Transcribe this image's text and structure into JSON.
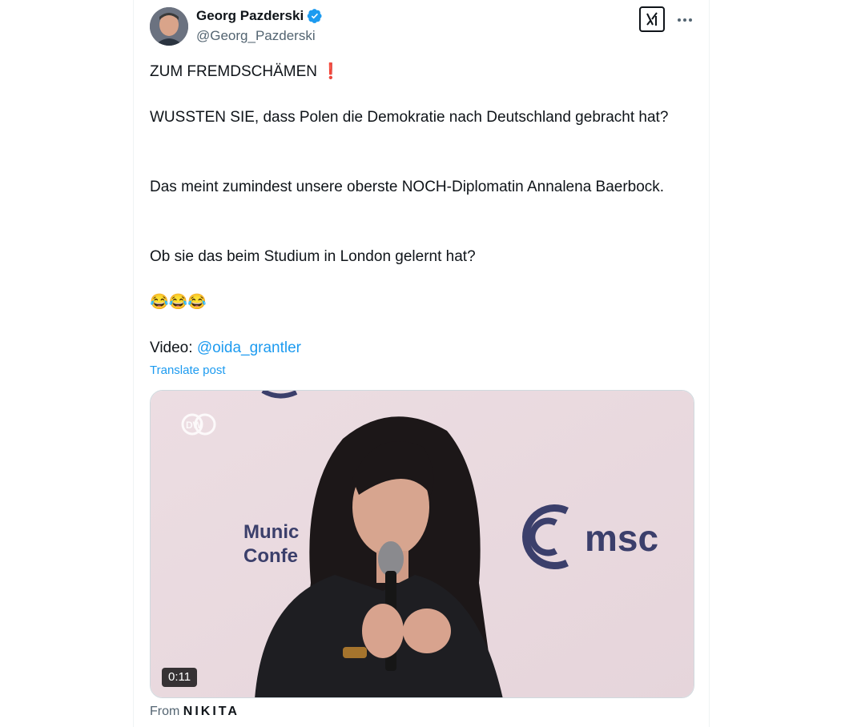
{
  "author": {
    "name": "Georg Pazderski",
    "handle": "@Georg_Pazderski",
    "verified": true
  },
  "tweet": {
    "line1": "ZUM FREMDSCHÄMEN",
    "line1_emoji": "❗",
    "para2": "WUSSTEN SIE, dass Polen die Demokratie nach Deutschland gebracht hat?",
    "para3": "Das meint zumindest unsere oberste NOCH-Diplomatin Annalena Baerbock.",
    "para4": "Ob sie das beim Studium in London gelernt hat?",
    "emojis": "😂😂😂",
    "video_label": "Video: ",
    "video_mention": "@oida_grantler",
    "translate_label": "Translate post"
  },
  "media": {
    "duration": "0:11",
    "watermark": "DW",
    "backdrop_text_line1": "Munic",
    "backdrop_text_line2": "Confe",
    "backdrop_logo_text": "msc"
  },
  "footer": {
    "from_label": "From",
    "from_name": "NIKITA"
  },
  "colors": {
    "accent": "#1d9bf0",
    "secondary_text": "#536471",
    "primary_text": "#0f1419"
  }
}
